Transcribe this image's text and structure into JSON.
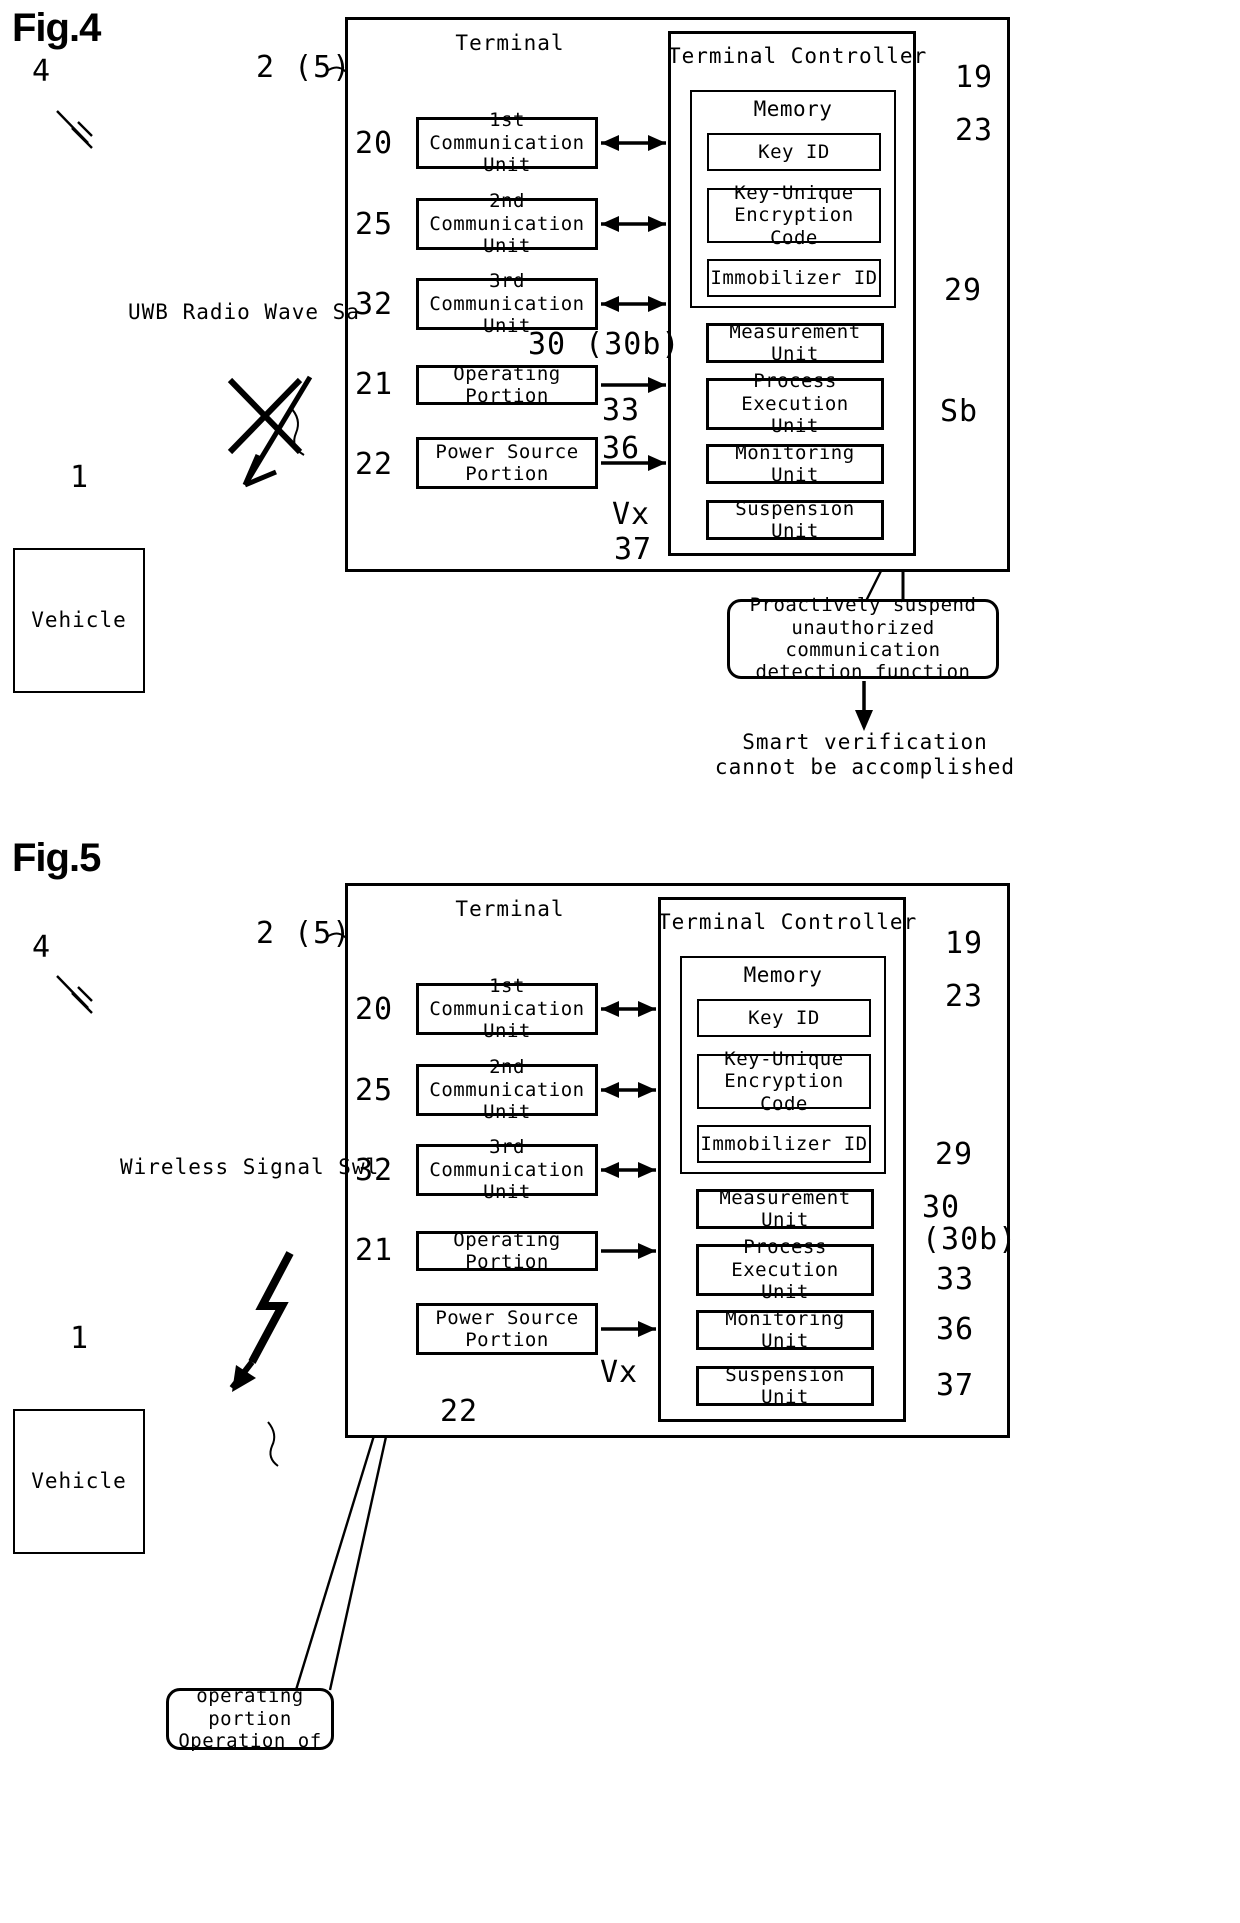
{
  "figures": [
    {
      "id": "fig4",
      "title": "Fig.4",
      "system_ref": "4",
      "vehicle_label": "Vehicle",
      "vehicle_ref": "1",
      "terminal_ref": "2 (5)",
      "terminal_title": "Terminal",
      "controller_title": "Terminal Controller",
      "controller_ref": "19",
      "memory_title": "Memory",
      "memory_ref": "23",
      "signal_label": "UWB Radio Wave Sa",
      "signal_blocked": true,
      "side_ref": "Sb",
      "left_units": [
        {
          "ref": "20",
          "label": "1st Communication\nUnit",
          "arrow": "double"
        },
        {
          "ref": "25",
          "label": "2nd Communication\nUnit",
          "arrow": "double"
        },
        {
          "ref": "32",
          "label": "3rd Communication\nUnit",
          "arrow": "double"
        },
        {
          "ref": "21",
          "label": "Operating Portion",
          "arrow": "single"
        },
        {
          "ref": "22",
          "label": "Power Source\nPortion",
          "arrow": "single"
        }
      ],
      "memory_items": [
        {
          "label": "Key ID"
        },
        {
          "label": "Key-Unique\nEncryption Code"
        },
        {
          "label": "Immobilizer ID"
        }
      ],
      "right_units": [
        {
          "ref": "29",
          "label": "Measurement Unit"
        },
        {
          "ref": "33",
          "label": "Process Execution\nUnit"
        },
        {
          "ref": "36",
          "label": "Monitoring Unit"
        },
        {
          "ref": "37",
          "label": "Suspension Unit"
        }
      ],
      "inline_refs": [
        {
          "text": "30 (30b)"
        },
        {
          "text": "33"
        },
        {
          "text": "36"
        },
        {
          "text": "Vx"
        },
        {
          "text": "37"
        }
      ],
      "callout": "Proactively suspend\nunauthorized communication\ndetection function",
      "conclusion": "Smart verification\ncannot be accomplished"
    },
    {
      "id": "fig5",
      "title": "Fig.5",
      "system_ref": "4",
      "vehicle_label": "Vehicle",
      "vehicle_ref": "1",
      "terminal_ref": "2 (5)",
      "terminal_title": "Terminal",
      "controller_title": "Terminal Controller",
      "controller_ref": "19",
      "memory_title": "Memory",
      "memory_ref": "23",
      "signal_label": "Wireless Signal Swl",
      "signal_blocked": false,
      "left_units": [
        {
          "ref": "20",
          "label": "1st Communication\nUnit",
          "arrow": "double"
        },
        {
          "ref": "25",
          "label": "2nd Communication\nUnit",
          "arrow": "double"
        },
        {
          "ref": "32",
          "label": "3rd Communication\nUnit",
          "arrow": "double"
        },
        {
          "ref": "21",
          "label": "Operating Portion",
          "arrow": "single"
        },
        {
          "ref": "22",
          "label": "Power Source\nPortion",
          "arrow": "single"
        }
      ],
      "memory_items": [
        {
          "label": "Key ID"
        },
        {
          "label": "Key-Unique\nEncryption Code"
        },
        {
          "label": "Immobilizer ID"
        }
      ],
      "right_units": [
        {
          "ref": "29",
          "label": "Measurement Unit",
          "ref2": "30\n(30b)"
        },
        {
          "ref": "33",
          "label": "Process Execution\nUnit"
        },
        {
          "ref": "36",
          "label": "Monitoring Unit"
        },
        {
          "ref": "37",
          "label": "Suspension Unit"
        }
      ],
      "inline_refs": [
        {
          "text": "Vx"
        },
        {
          "text": "22"
        }
      ],
      "callout": "operating portion\nOperation of"
    }
  ]
}
